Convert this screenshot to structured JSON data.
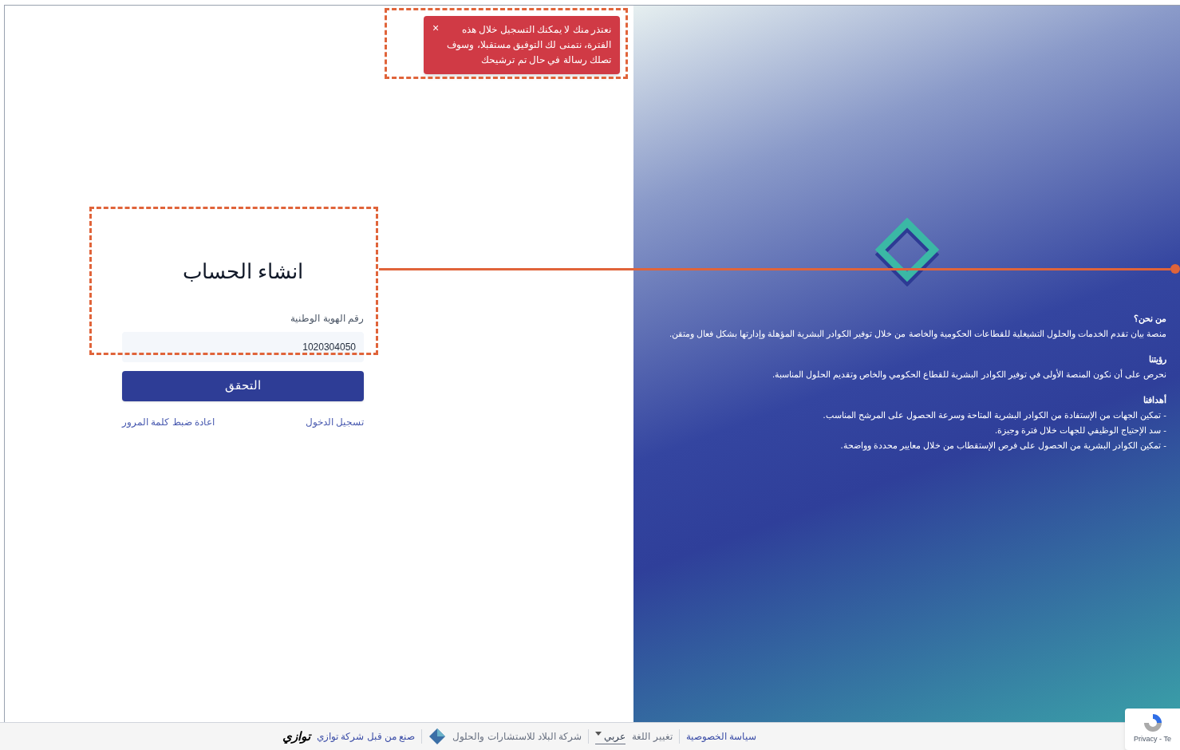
{
  "toast": {
    "message": "نعتذر منك لا يمكنك التسجيل خلال هذه الفترة، نتمنى لك التوفيق مستقبلا، وسوف تصلك رسالة في حال تم ترشيحك",
    "close": "×"
  },
  "form": {
    "title": "انشاء الحساب",
    "field": {
      "label": "رقم الهوية الوطنية",
      "value": "1020304050"
    },
    "submit": "التحقق",
    "links": [
      "تسجيل الدخول",
      "اعادة ضبط كلمة المرور"
    ]
  },
  "about": {
    "sections": [
      {
        "heading": "من نحن؟",
        "paragraph": "منصة بيان تقدم الخدمات والحلول التشيغلية للقطاعات الحكومية والخاصة من خلال توفير الكوادر البشرية المؤهلة وإدارتها بشكل فعال ومتقن."
      },
      {
        "heading": "رؤيتنا",
        "paragraph": "نحرص على أن نكون المنصة الأولى في توفير الكوادر البشرية للقطاع الحكومي والخاص وتقديم الحلول المناسبة."
      },
      {
        "heading": "أهدافنا",
        "bullets": [
          "- تمكين الجهات من الإستفادة من الكوادر البشرية المتاحة وسرعة الحصول على المرشح المناسب.",
          "- سد الإحتياج الوظيفي للجهات خلال فترة وجيزة.",
          "- تمكين الكوادر البشرية من الحصول على فرص الإستقطاب من خلال معايير محددة وواضحة."
        ]
      }
    ]
  },
  "footer": {
    "privacy": "سياسة الخصوصية",
    "language_label": "تغيير اللغة",
    "language": "عربي",
    "company": "شركة البلاد للاستشارات والحلول",
    "made_by": "صنع من قبل شركة توازي",
    "logo_text": "توازي"
  },
  "recaptcha": {
    "text": "Privacy - Te"
  }
}
